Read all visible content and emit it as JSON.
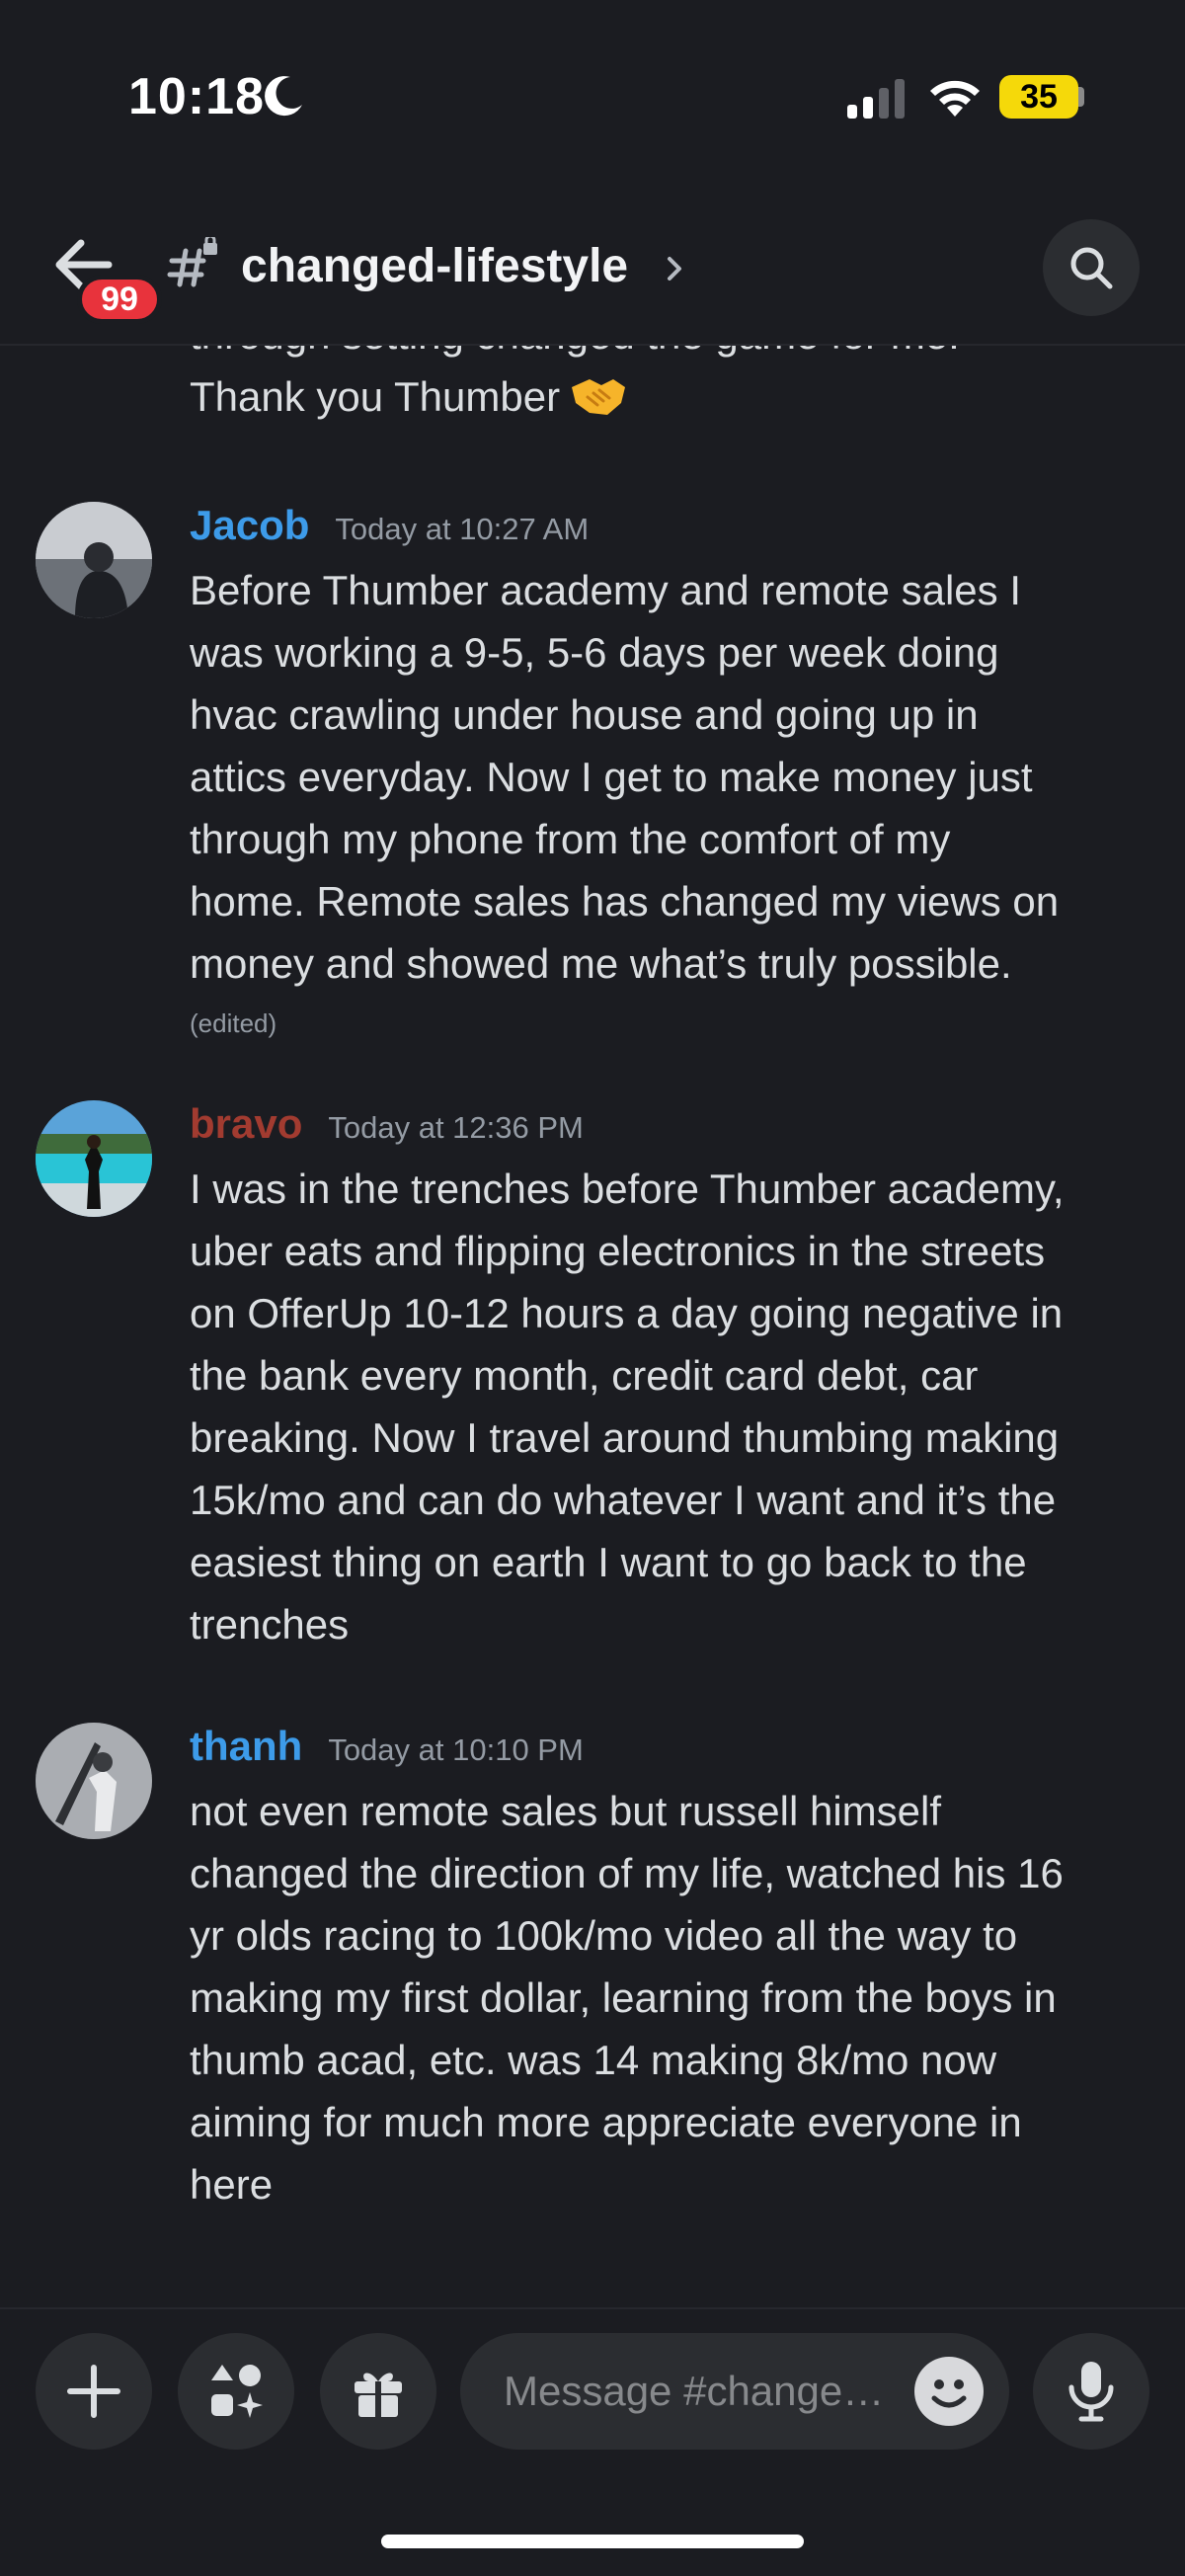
{
  "status_bar": {
    "time": "10:18",
    "battery": "35"
  },
  "header": {
    "unread_count": "99",
    "channel_name": "changed-lifestyle",
    "icons": {
      "back": "arrow-left-icon",
      "channel": "locked-hashtag-icon",
      "search": "search-icon"
    }
  },
  "messages": {
    "partial_text": "through setting changed the game for me.",
    "partial_text_2": "Thank you Thumber",
    "items": [
      {
        "username": "Jacob",
        "username_color": "#3d9be9",
        "timestamp": "Today at 10:27 AM",
        "lines": [
          "Before Thumber academy and remote sales I",
          "was working a 9-5, 5-6 days per week doing",
          "hvac crawling under house and going up in",
          "attics everyday. Now I get to make money just",
          "through my phone from the comfort of my",
          "home. Remote sales has changed my views on",
          "money and showed me what’s truly possible."
        ],
        "edited": "(edited)"
      },
      {
        "username": "bravo",
        "username_color": "#a23b30",
        "timestamp": "Today at 12:36 PM",
        "lines": [
          "I was in the trenches before Thumber academy,",
          "uber eats and flipping electronics in the streets",
          "on OfferUp 10-12 hours a day going negative in",
          "the bank every month, credit card debt, car",
          "breaking. Now I travel around thumbing making",
          "15k/mo and can do whatever I want and it’s the",
          "easiest thing on earth I want to go back to the",
          "trenches"
        ]
      },
      {
        "username": "thanh",
        "username_color": "#3d9be9",
        "timestamp": "Today at 10:10 PM",
        "lines": [
          "not even remote sales but russell himself",
          "changed the direction of my life, watched his 16",
          "yr olds racing to 100k/mo video all the way to",
          "making my first dollar, learning from the boys in",
          "thumb acad, etc. was 14 making 8k/mo now",
          "aiming for much more appreciate everyone in",
          "here"
        ]
      }
    ]
  },
  "composer": {
    "placeholder": "Message #change…",
    "icons": {
      "add": "plus-icon",
      "apps": "apps-icon",
      "gift": "gift-icon",
      "emoji": "emoji-icon",
      "voice": "microphone-icon"
    }
  }
}
